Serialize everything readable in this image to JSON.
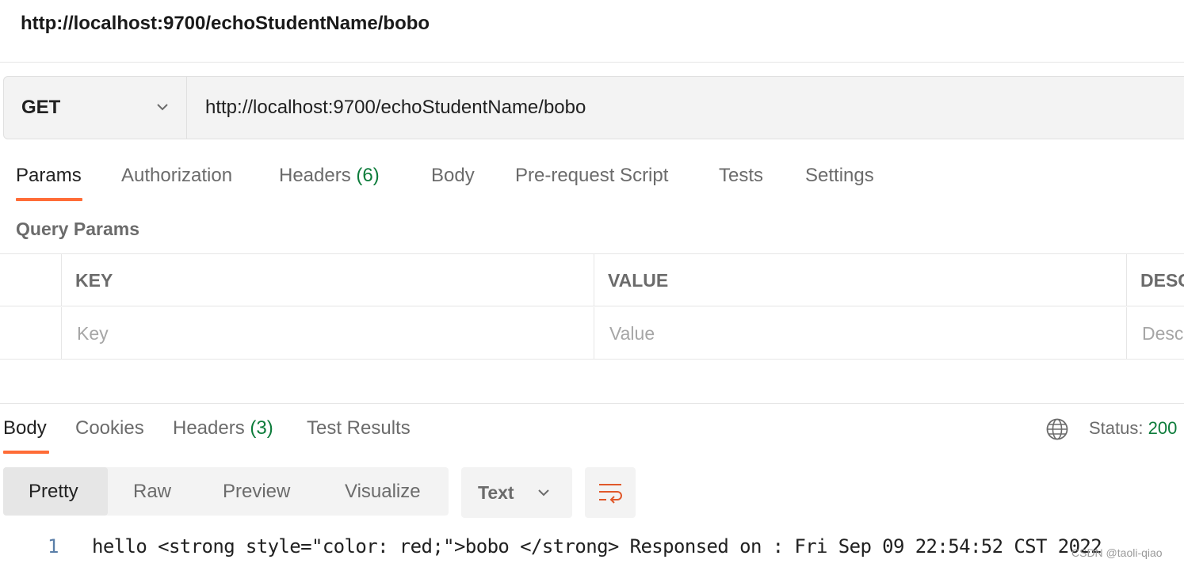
{
  "title": "http://localhost:9700/echoStudentName/bobo",
  "request": {
    "method": "GET",
    "url": "http://localhost:9700/echoStudentName/bobo"
  },
  "request_tabs": {
    "params": "Params",
    "authorization": "Authorization",
    "headers": "Headers",
    "headers_count": "(6)",
    "body": "Body",
    "pre_request_script": "Pre-request Script",
    "tests": "Tests",
    "settings": "Settings"
  },
  "query_params": {
    "title": "Query Params",
    "columns": {
      "key": "KEY",
      "value": "VALUE",
      "description": "DESCRIPTION"
    },
    "placeholders": {
      "key": "Key",
      "value": "Value",
      "description": "Description"
    }
  },
  "response_tabs": {
    "body": "Body",
    "cookies": "Cookies",
    "headers": "Headers",
    "headers_count": "(3)",
    "test_results": "Test Results"
  },
  "status": {
    "label": "Status:",
    "value": "200"
  },
  "view_modes": {
    "pretty": "Pretty",
    "raw": "Raw",
    "preview": "Preview",
    "visualize": "Visualize"
  },
  "format": "Text",
  "response_body": {
    "line_number": "1",
    "content": "hello  <strong style=\"color: red;\">bobo </strong> Responsed on : Fri Sep 09 22:54:52 CST 2022"
  },
  "watermark": "CSDN @taoli-qiao",
  "colors": {
    "accent": "#ff6c37",
    "success": "#0d7c3b"
  },
  "icons": {
    "method_dropdown": "chevron-down-icon",
    "globe": "globe-icon",
    "wrap": "wrap-lines-icon"
  }
}
